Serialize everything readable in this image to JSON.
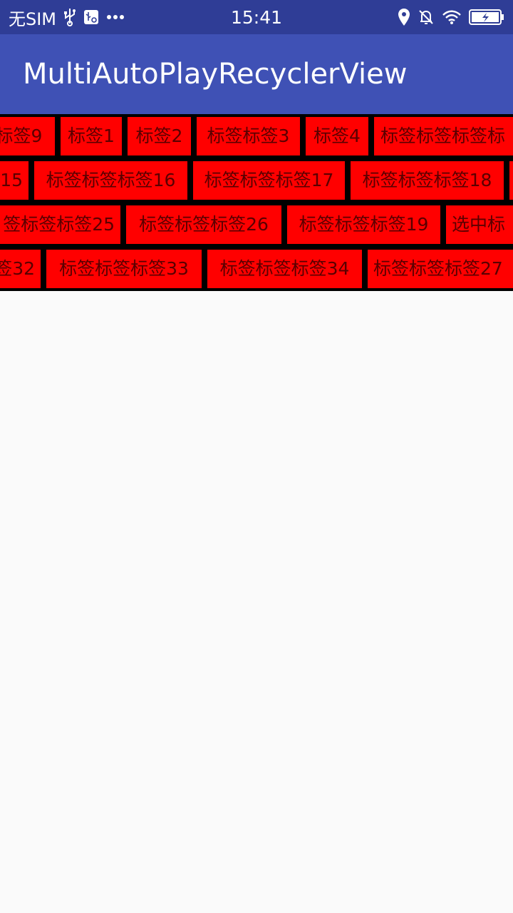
{
  "status_bar": {
    "carrier": "无SIM",
    "time": "15:41",
    "left_icons": [
      "usb-icon",
      "usb-settings-icon",
      "more-dots-icon"
    ],
    "right_icons": [
      "location-icon",
      "alarm-off-icon",
      "wifi-icon",
      "battery-charging-icon"
    ]
  },
  "toolbar": {
    "title": "MultiAutoPlayRecyclerView"
  },
  "tag_rows": [
    [
      "标签9",
      "标签1",
      "标签2",
      "标签标签3",
      "标签4",
      "标签标签标签标"
    ],
    [
      "15",
      "标签标签标签16",
      "标签标签标签17",
      "标签标签标签18",
      ""
    ],
    [
      "签标签标签25",
      "标签标签标签26",
      "标签标签标签19",
      "选中标"
    ],
    [
      "签32",
      "标签标签标签33",
      "标签标签标签34",
      "标签标签标签27"
    ]
  ],
  "colors": {
    "status_bar": "#2f3d96",
    "toolbar": "#3f51b5",
    "tag_background": "#ff0000",
    "tag_text": "#5a0000",
    "divider": "#000000",
    "page_background": "#fafafa"
  }
}
